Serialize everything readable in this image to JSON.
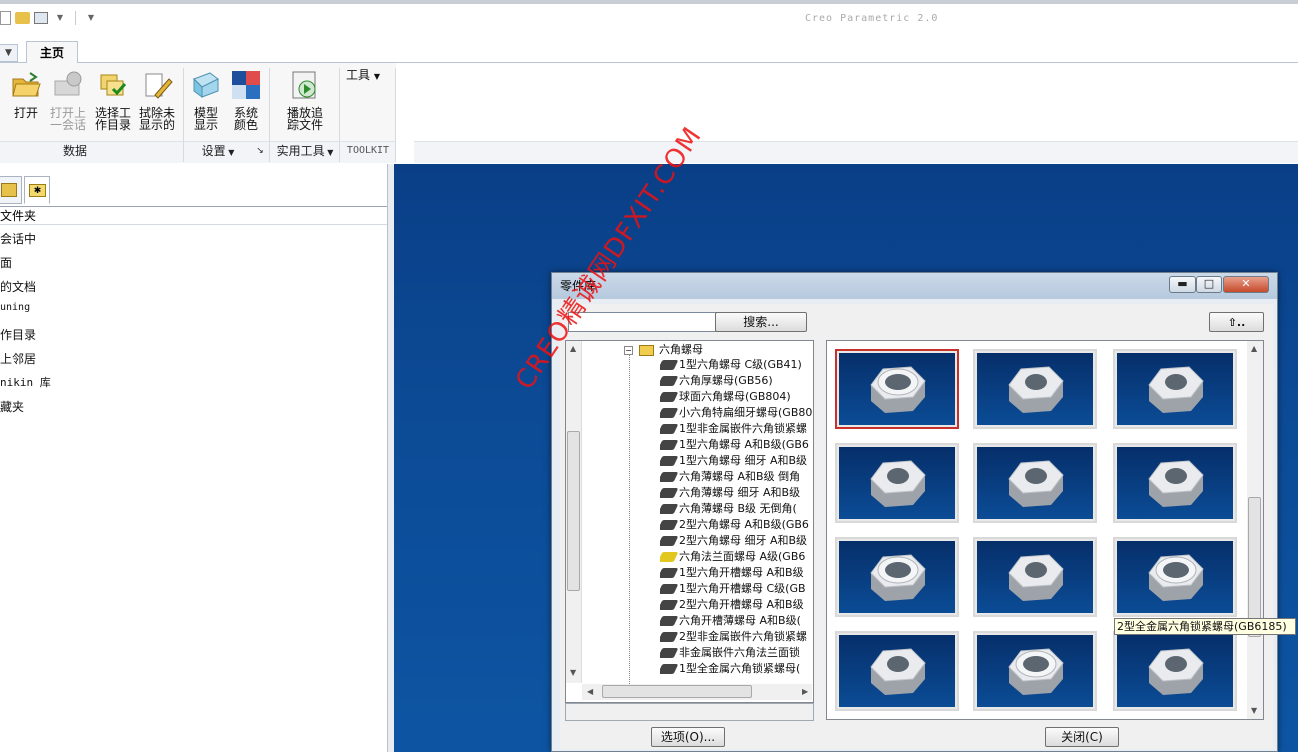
{
  "app_title": "Creo Parametric 2.0",
  "ribbon": {
    "tab_home": "主页",
    "buttons": {
      "open": "打开",
      "open_last_1": "打开上",
      "open_last_2": "一会话",
      "select_wd_1": "选择工",
      "select_wd_2": "作目录",
      "erase_1": "拭除未",
      "erase_2": "显示的",
      "model_display_1": "模型",
      "model_display_2": "显示",
      "system_color_1": "系统",
      "system_color_2": "颜色",
      "play_trail_1": "播放追",
      "play_trail_2": "踪文件",
      "tools": "工具"
    },
    "groups": {
      "data": "数据",
      "settings": "设置",
      "utilities": "实用工具",
      "toolkit": "TOOLKIT"
    }
  },
  "navigator": {
    "header": "文件夹",
    "items": [
      "会话中",
      "面",
      "的文档",
      "uning",
      "作目录",
      "上邻居",
      "nikin 库",
      "藏夹"
    ]
  },
  "dialog": {
    "title": "零件库",
    "search_button": "搜索...",
    "options_button": "选项(O)...",
    "close_button": "关闭(C)",
    "tooltip": "2型全金属六角锁紧螺母(GB6185)",
    "tree": {
      "folder": "六角螺母",
      "items": [
        "1型六角螺母 C级(GB41)",
        "六角厚螺母(GB56)",
        "球面六角螺母(GB804)",
        "小六角特扁细牙螺母(GB80",
        "1型非金属嵌件六角锁紧螺",
        "1型六角螺母 A和B级(GB6",
        "1型六角螺母 细牙 A和B级",
        "六角薄螺母 A和B级 倒角",
        "六角薄螺母 细牙 A和B级",
        "六角薄螺母 B级 无倒角(",
        "2型六角螺母 A和B级(GB6",
        "2型六角螺母 细牙 A和B级",
        "六角法兰面螺母 A级(GB6",
        "1型六角开槽螺母 A和B级",
        "1型六角开槽螺母 C级(GB",
        "2型六角开槽螺母 A和B级",
        "六角开槽薄螺母 A和B级(",
        "2型非金属嵌件六角锁紧螺",
        "非金属嵌件六角法兰面锁",
        "1型全金属六角锁紧螺母("
      ]
    }
  },
  "watermark": "CREO精诚网DFXIT.COM",
  "colors": {
    "graphics_bg": "#0c4a95",
    "selection_border": "#c8302a",
    "watermark": "#ee1111"
  }
}
